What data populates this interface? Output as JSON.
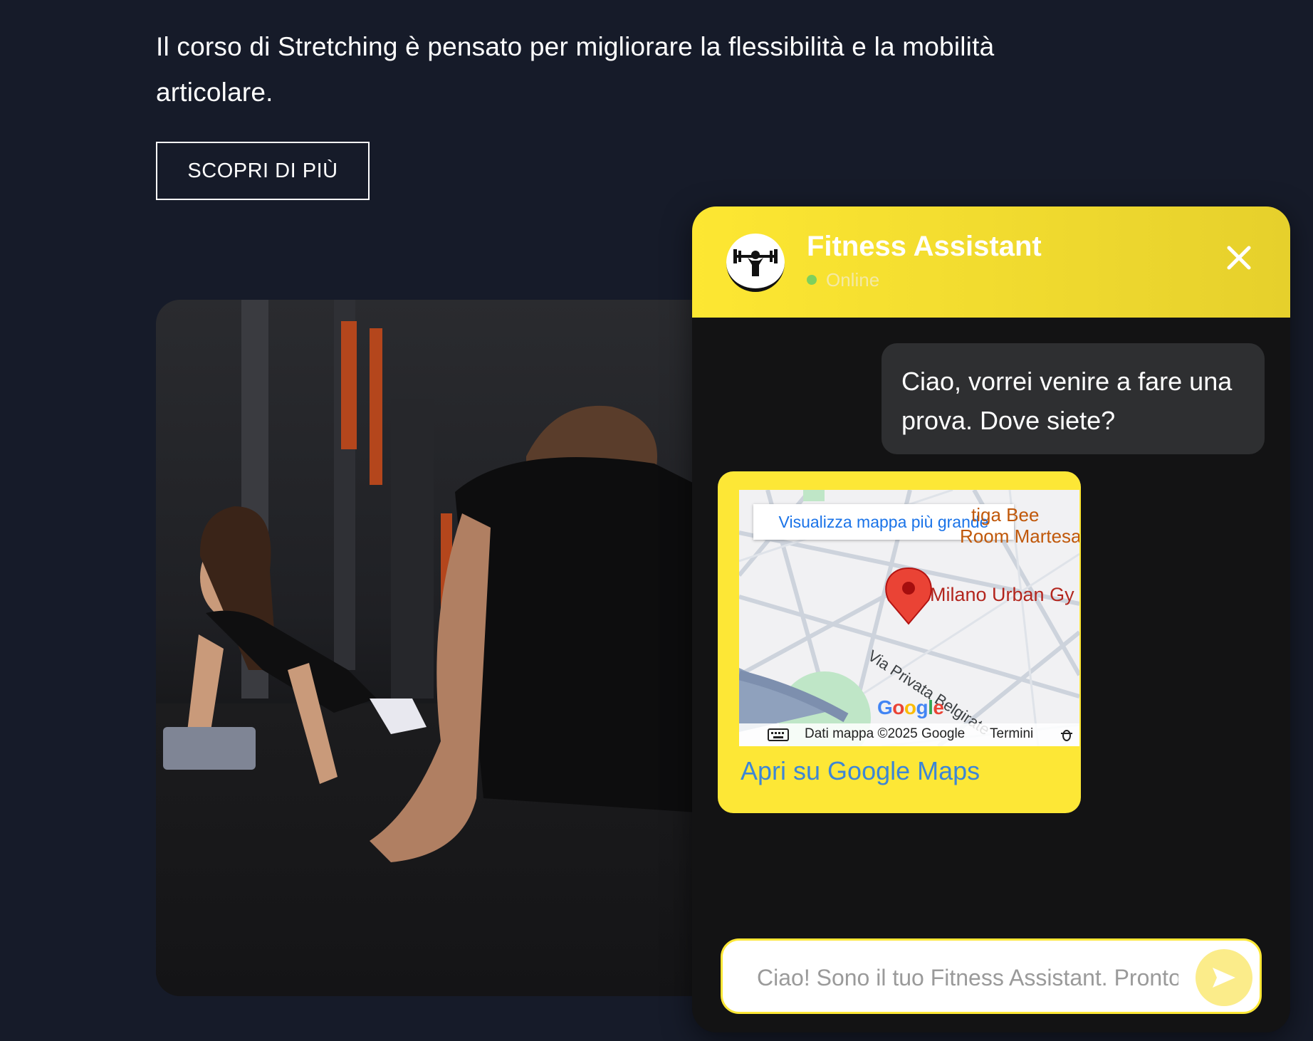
{
  "page": {
    "intro_text": "Il corso di Stretching è pensato per migliorare la flessibilità e la mobilità articolare.",
    "cta_label": "SCOPRI DI PIÙ"
  },
  "chat": {
    "title": "Fitness Assistant",
    "status": "Online",
    "avatar_icon": "weightlifter-icon",
    "close_icon": "close-icon",
    "colors": {
      "header": "#fde732",
      "status_dot": "#7ed05d",
      "bubble": "#2e2f31",
      "link": "#3d86d6"
    },
    "messages": [
      {
        "from": "user",
        "text": "Ciao, vorrei venire a fare una prova. Dove siete?"
      }
    ],
    "map_card": {
      "view_larger": "Visualizza mappa più grande",
      "place_label": "Milano Urban Gy",
      "poi_label_1": "tiga Bee",
      "poi_label_2": "Room Martesan",
      "street_label": "Via Privata Belgirate",
      "google_logo": "Google",
      "attribution": "Dati mappa ©2025 Google",
      "terms": "Termini",
      "open_link": "Apri su Google Maps"
    },
    "input": {
      "placeholder": "Ciao! Sono il tuo Fitness Assistant. Pronto",
      "send_icon": "send-icon"
    }
  }
}
